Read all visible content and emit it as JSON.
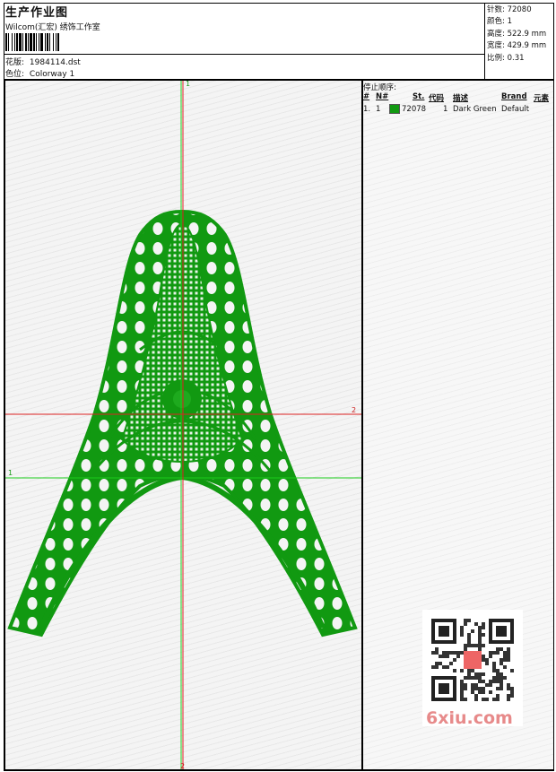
{
  "header": {
    "title": "生产作业图",
    "company": "Wilcom(汇宏) 绣饰工作室",
    "design_label": "花版:",
    "design_value": "1984114.dst",
    "colorway_label": "色位:",
    "colorway_value": "Colorway 1"
  },
  "stats": {
    "stitches_label": "针数:",
    "stitches_value": "72080",
    "colors_label": "颜色:",
    "colors_value": "1",
    "height_label": "高度:",
    "height_value": "522.9 mm",
    "width_label": "宽度:",
    "width_value": "429.9 mm",
    "scale_label": "比例:",
    "scale_value": "0.31"
  },
  "stop_sequence": {
    "title": "停止顺序:",
    "columns": [
      "#",
      "N#",
      "St.",
      "代码",
      "描述",
      "Brand",
      "元素"
    ],
    "rows": [
      {
        "index": "1.",
        "n": "1",
        "stitches": "72078",
        "code": "1",
        "description": "Dark Green",
        "brand": "Default",
        "color": "#119911"
      }
    ]
  },
  "guides": {
    "green_vertical_label": "1",
    "green_horizontal_label": "1",
    "red_horizontal_label": "2",
    "red_vertical_label": "2"
  },
  "design": {
    "thread_color": "#119911",
    "icon": "eiffel-tower-embroidery"
  },
  "watermark": {
    "text": "6xiu.com",
    "qr_icon": "qr-code-icon"
  }
}
